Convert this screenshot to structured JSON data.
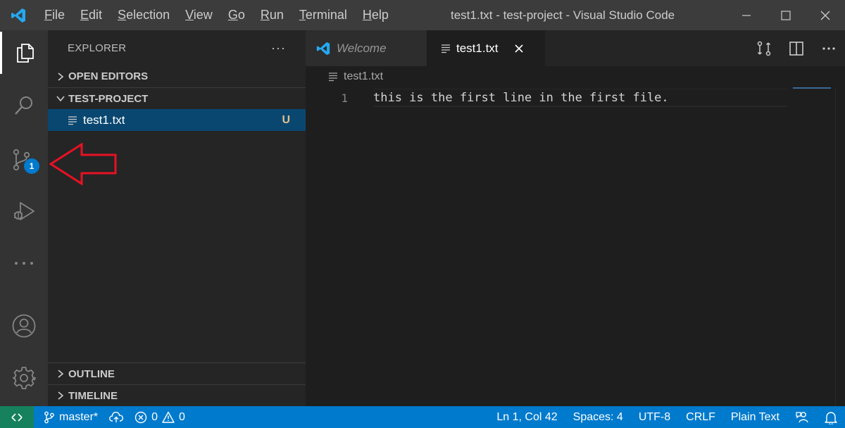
{
  "titlebar": {
    "menu": {
      "file": {
        "accel": "F",
        "rest": "ile"
      },
      "edit": {
        "accel": "E",
        "rest": "dit"
      },
      "selection": {
        "accel": "S",
        "rest": "election"
      },
      "view": {
        "accel": "V",
        "rest": "iew"
      },
      "go": {
        "accel": "G",
        "rest": "o"
      },
      "run": {
        "accel": "R",
        "rest": "un"
      },
      "terminal": {
        "accel": "T",
        "rest": "erminal"
      },
      "help": {
        "accel": "H",
        "rest": "elp"
      }
    },
    "window_title": "test1.txt - test-project - Visual Studio Code"
  },
  "activity_bar": {
    "source_control_badge": "1"
  },
  "sidebar": {
    "title": "EXPLORER",
    "more": "···",
    "sections": {
      "open_editors": "OPEN EDITORS",
      "project": "TEST-PROJECT",
      "outline": "OUTLINE",
      "timeline": "TIMELINE"
    },
    "files": [
      {
        "name": "test1.txt",
        "status": "U"
      }
    ]
  },
  "editor": {
    "tabs": [
      {
        "label": "Welcome"
      },
      {
        "label": "test1.txt"
      }
    ],
    "breadcrumb": "test1.txt",
    "lines": [
      {
        "number": "1",
        "text": "this is the first line in the first file."
      }
    ]
  },
  "statusbar": {
    "branch": "master*",
    "errors": "0",
    "warnings": "0",
    "position": "Ln 1, Col 42",
    "spaces": "Spaces: 4",
    "encoding": "UTF-8",
    "eol": "CRLF",
    "language": "Plain Text"
  },
  "colors": {
    "accent": "#007acc",
    "remote": "#16825d",
    "selection": "#094771",
    "untracked": "#e2c08d",
    "annotation": "#e81123"
  }
}
